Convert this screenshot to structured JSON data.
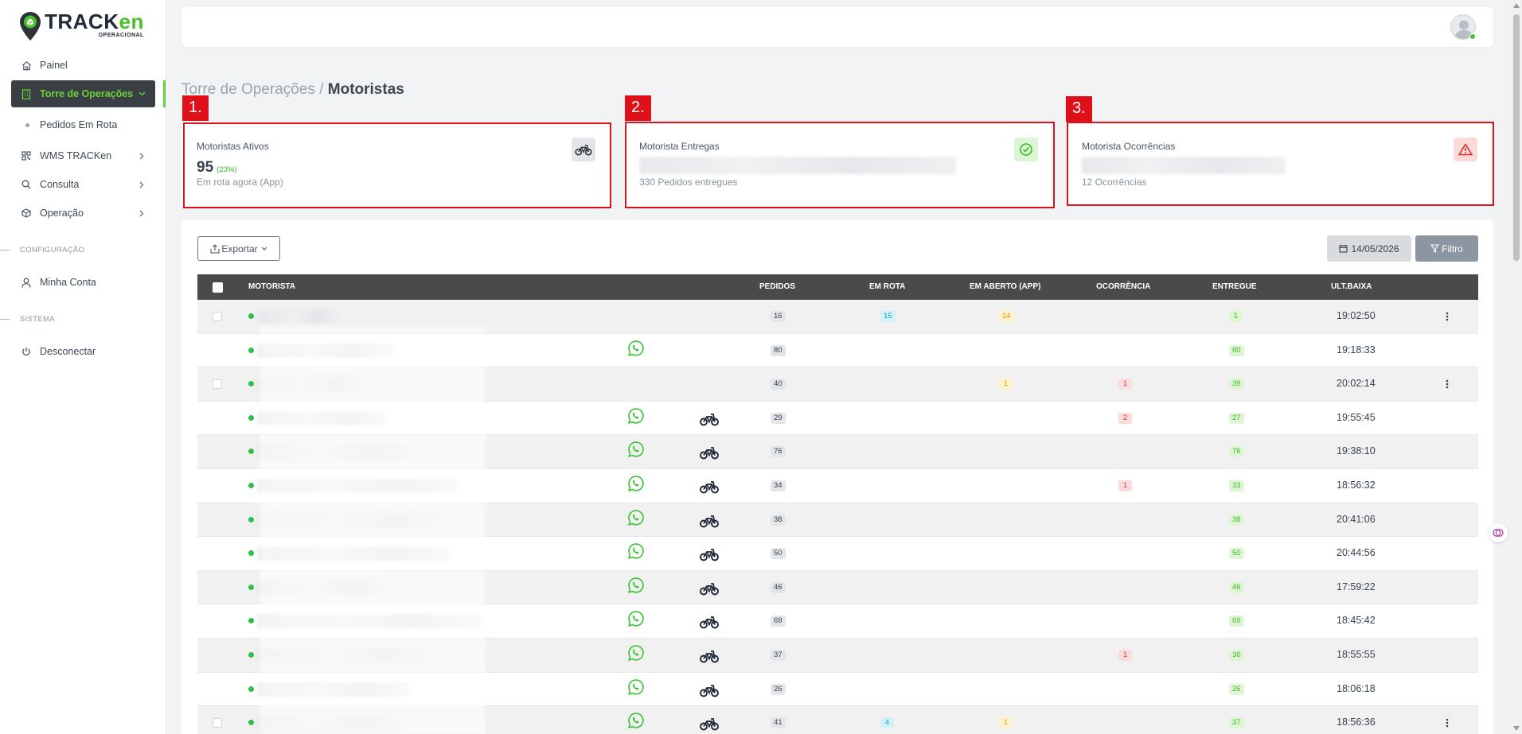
{
  "brand": {
    "name_main": "TRACK",
    "name_accent": "en",
    "subtitle": "OPERACIONAL"
  },
  "sidebar": {
    "items": [
      {
        "label": "Painel",
        "icon": "home-icon"
      },
      {
        "label": "Torre de Operações",
        "icon": "building-icon",
        "active": true
      },
      {
        "label": "WMS TRACKen",
        "icon": "qrcode-icon"
      },
      {
        "label": "Consulta",
        "icon": "search-icon"
      },
      {
        "label": "Operação",
        "icon": "box-icon"
      },
      {
        "label": "Minha Conta",
        "icon": "user-icon"
      },
      {
        "label": "Desconectar",
        "icon": "power-icon"
      }
    ],
    "sub_items": [
      {
        "label": "Pedidos Em Rota"
      }
    ],
    "sections": [
      {
        "label": "CONFIGURAÇÃO"
      },
      {
        "label": "SISTEMA"
      }
    ]
  },
  "breadcrumb": {
    "parent": "Torre de Operações",
    "separator": " / ",
    "current": "Motoristas"
  },
  "cards": [
    {
      "marker": "1.",
      "title": "Motoristas Ativos",
      "value": "95",
      "percent": "(23%)",
      "subtitle": "Em rota agora (App)",
      "icon": "bike-icon",
      "icon_bg": "#e3e5e8"
    },
    {
      "marker": "2.",
      "title": "Motorista Entregas",
      "subtitle": "330 Pedidos entregues",
      "icon": "check-circle-icon",
      "icon_bg": "#dcf5d5"
    },
    {
      "marker": "3.",
      "title": "Motorista Ocorrências",
      "subtitle": "12 Ocorrências",
      "icon": "warning-icon",
      "icon_bg": "#fcdada"
    }
  ],
  "toolbar": {
    "export_label": "Exportar",
    "date_label": "14/05/2026",
    "filter_label": "Filtro"
  },
  "table": {
    "headers": {
      "motorista": "MOTORISTA",
      "pedidos": "PEDIDOS",
      "em_rota": "EM ROTA",
      "em_aberto": "EM ABERTO (APP)",
      "ocorrencia": "OCORRÊNCIA",
      "entregue": "ENTREGUE",
      "ult_baixa": "ULT.BAIXA"
    },
    "rows": [
      {
        "pedidos": "16",
        "em_rota": "15",
        "em_aberto": "14",
        "ocorrencia": "",
        "entregue": "1",
        "ult_baixa": "19:02:50",
        "whatsapp": false,
        "bike": false,
        "checkbox": true,
        "menu": true
      },
      {
        "pedidos": "80",
        "em_rota": "",
        "em_aberto": "",
        "ocorrencia": "",
        "entregue": "80",
        "ult_baixa": "19:18:33",
        "whatsapp": true,
        "bike": false,
        "checkbox": false,
        "menu": false
      },
      {
        "pedidos": "40",
        "em_rota": "",
        "em_aberto": "1",
        "ocorrencia": "1",
        "entregue": "39",
        "ult_baixa": "20:02:14",
        "whatsapp": false,
        "bike": false,
        "checkbox": true,
        "menu": true
      },
      {
        "pedidos": "29",
        "em_rota": "",
        "em_aberto": "",
        "ocorrencia": "2",
        "entregue": "27",
        "ult_baixa": "19:55:45",
        "whatsapp": true,
        "bike": true,
        "checkbox": false,
        "menu": false
      },
      {
        "pedidos": "76",
        "em_rota": "",
        "em_aberto": "",
        "ocorrencia": "",
        "entregue": "76",
        "ult_baixa": "19:38:10",
        "whatsapp": true,
        "bike": true,
        "checkbox": false,
        "menu": false
      },
      {
        "pedidos": "34",
        "em_rota": "",
        "em_aberto": "",
        "ocorrencia": "1",
        "entregue": "33",
        "ult_baixa": "18:56:32",
        "whatsapp": true,
        "bike": true,
        "checkbox": false,
        "menu": false
      },
      {
        "pedidos": "38",
        "em_rota": "",
        "em_aberto": "",
        "ocorrencia": "",
        "entregue": "38",
        "ult_baixa": "20:41:06",
        "whatsapp": true,
        "bike": true,
        "checkbox": false,
        "menu": false
      },
      {
        "pedidos": "50",
        "em_rota": "",
        "em_aberto": "",
        "ocorrencia": "",
        "entregue": "50",
        "ult_baixa": "20:44:56",
        "whatsapp": true,
        "bike": true,
        "checkbox": false,
        "menu": false
      },
      {
        "pedidos": "46",
        "em_rota": "",
        "em_aberto": "",
        "ocorrencia": "",
        "entregue": "46",
        "ult_baixa": "17:59:22",
        "whatsapp": true,
        "bike": true,
        "checkbox": false,
        "menu": false
      },
      {
        "pedidos": "69",
        "em_rota": "",
        "em_aberto": "",
        "ocorrencia": "",
        "entregue": "69",
        "ult_baixa": "18:45:42",
        "whatsapp": true,
        "bike": true,
        "checkbox": false,
        "menu": false
      },
      {
        "pedidos": "37",
        "em_rota": "",
        "em_aberto": "",
        "ocorrencia": "1",
        "entregue": "36",
        "ult_baixa": "18:55:55",
        "whatsapp": true,
        "bike": true,
        "checkbox": false,
        "menu": false
      },
      {
        "pedidos": "26",
        "em_rota": "",
        "em_aberto": "",
        "ocorrencia": "",
        "entregue": "26",
        "ult_baixa": "18:06:18",
        "whatsapp": true,
        "bike": true,
        "checkbox": false,
        "menu": false
      },
      {
        "pedidos": "41",
        "em_rota": "4",
        "em_aberto": "1",
        "ocorrencia": "",
        "entregue": "37",
        "ult_baixa": "18:56:36",
        "whatsapp": true,
        "bike": true,
        "checkbox": true,
        "menu": true
      }
    ]
  },
  "colors": {
    "accent_green": "#6bd338",
    "highlight_red": "#e0101b",
    "header_dark": "#4a4a4a"
  }
}
